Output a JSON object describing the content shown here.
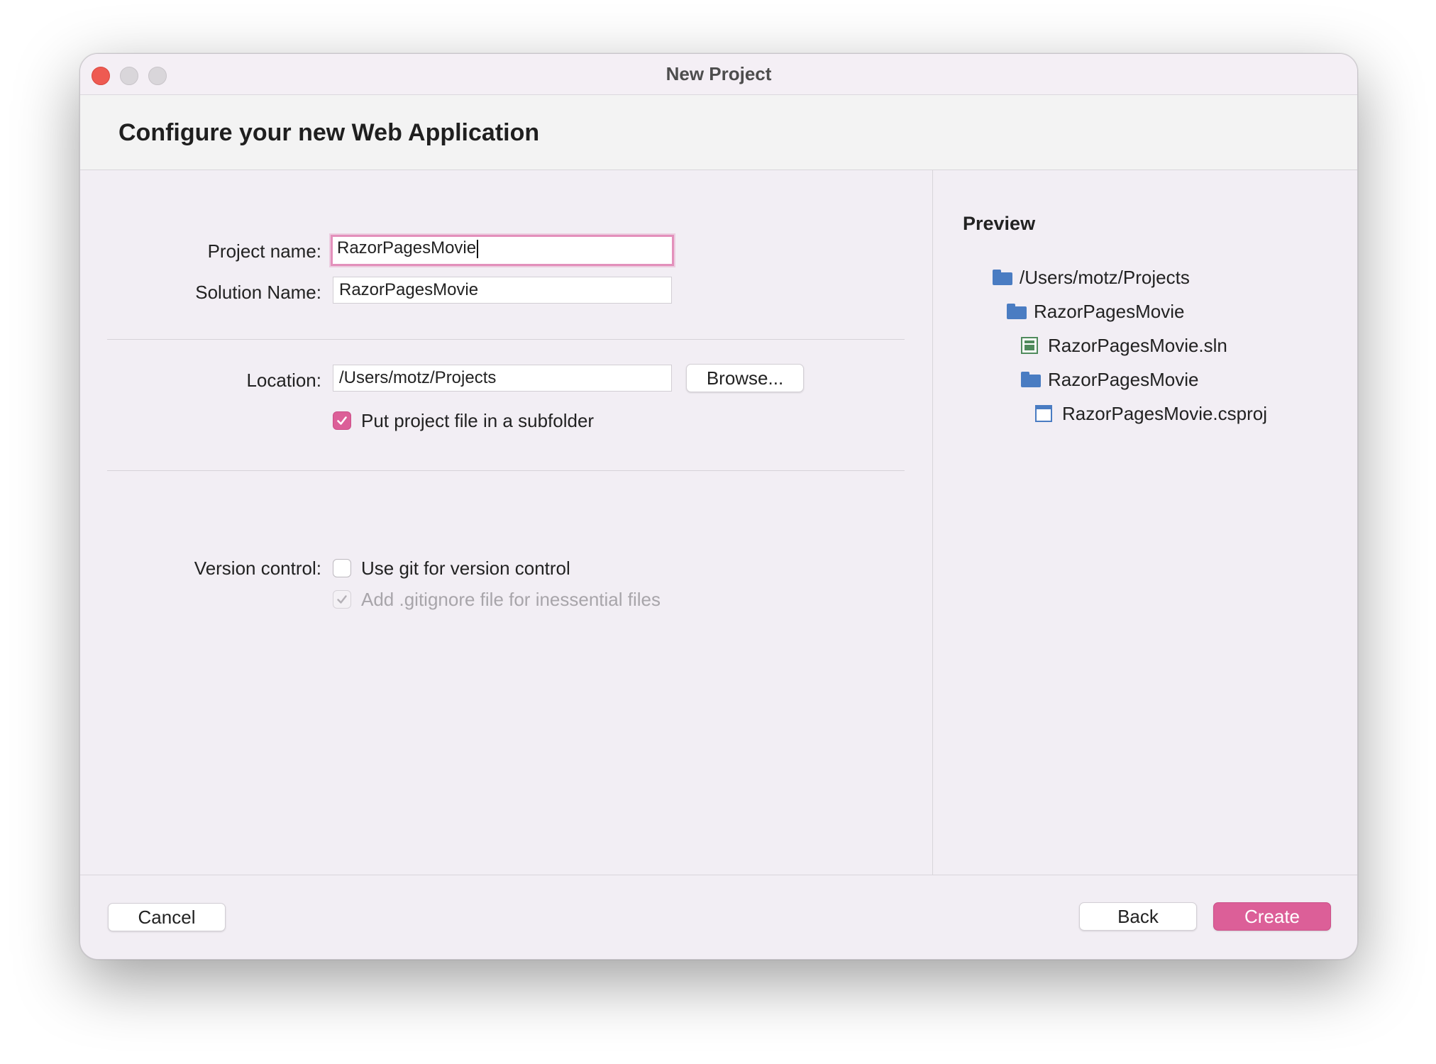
{
  "window": {
    "title": "New Project"
  },
  "header": {
    "title": "Configure your new Web Application"
  },
  "form": {
    "project_name_label": "Project name:",
    "project_name_value": "RazorPagesMovie",
    "solution_name_label": "Solution Name:",
    "solution_name_value": "RazorPagesMovie",
    "location_label": "Location:",
    "location_value": "/Users/motz/Projects",
    "browse_label": "Browse...",
    "subfolder_label": "Put project file in a subfolder",
    "subfolder_checked": true,
    "version_control_label": "Version control:",
    "use_git_label": "Use git for version control",
    "use_git_checked": false,
    "gitignore_label": "Add .gitignore file for inessential files",
    "gitignore_checked": true,
    "gitignore_enabled": false
  },
  "preview": {
    "title": "Preview",
    "tree": [
      {
        "label": "/Users/motz/Projects",
        "icon": "folder-icon",
        "depth": 0
      },
      {
        "label": "RazorPagesMovie",
        "icon": "folder-icon",
        "depth": 1
      },
      {
        "label": "RazorPagesMovie.sln",
        "icon": "solution-file-icon",
        "depth": 2
      },
      {
        "label": "RazorPagesMovie",
        "icon": "folder-icon",
        "depth": 2
      },
      {
        "label": "RazorPagesMovie.csproj",
        "icon": "project-file-icon",
        "depth": 3
      }
    ]
  },
  "footer": {
    "cancel_label": "Cancel",
    "back_label": "Back",
    "create_label": "Create"
  },
  "colors": {
    "accent": "#dc5f98",
    "focus_ring": "#e390bb",
    "folder": "#4a7cc2",
    "solution": "#4f8a5c",
    "close_button": "#ee5a52"
  }
}
